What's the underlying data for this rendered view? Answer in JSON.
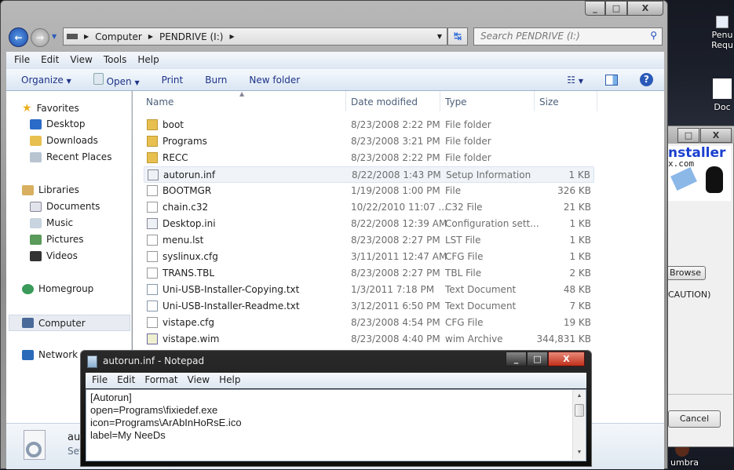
{
  "desktop": {
    "icons": [
      "Penu",
      "Requ",
      "Doc"
    ],
    "bottom_icon": "umbra"
  },
  "explorer": {
    "caption": {
      "minimize": "_",
      "maximize": "□",
      "close": "X"
    },
    "address": {
      "crumbs": [
        "Computer",
        "PENDRIVE (I:)"
      ]
    },
    "search": {
      "placeholder": "Search PENDRIVE (I:)"
    },
    "menu": [
      "File",
      "Edit",
      "View",
      "Tools",
      "Help"
    ],
    "toolbar": {
      "organize": "Organize",
      "open": "Open",
      "print": "Print",
      "burn": "Burn",
      "new_folder": "New folder"
    },
    "nav": {
      "favorites": "Favorites",
      "desktop": "Desktop",
      "downloads": "Downloads",
      "recent": "Recent Places",
      "libraries": "Libraries",
      "documents": "Documents",
      "music": "Music",
      "pictures": "Pictures",
      "videos": "Videos",
      "homegroup": "Homegroup",
      "computer": "Computer",
      "network": "Network"
    },
    "columns": {
      "name": "Name",
      "date": "Date modified",
      "type": "Type",
      "size": "Size"
    },
    "files": [
      {
        "name": "boot",
        "date": "8/23/2008 2:22 PM",
        "type": "File folder",
        "size": "",
        "icon": "folder"
      },
      {
        "name": "Programs",
        "date": "8/23/2008 3:21 PM",
        "type": "File folder",
        "size": "",
        "icon": "folder"
      },
      {
        "name": "RECC",
        "date": "8/23/2008 2:22 PM",
        "type": "File folder",
        "size": "",
        "icon": "folder"
      },
      {
        "name": "autorun.inf",
        "date": "8/22/2008 1:43 PM",
        "type": "Setup Information",
        "size": "1 KB",
        "icon": "settings"
      },
      {
        "name": "BOOTMGR",
        "date": "1/19/2008 1:00 PM",
        "type": "File",
        "size": "326 KB",
        "icon": "file"
      },
      {
        "name": "chain.c32",
        "date": "10/22/2010 11:07 ...",
        "type": "C32 File",
        "size": "21 KB",
        "icon": "file"
      },
      {
        "name": "Desktop.ini",
        "date": "8/22/2008 12:39 AM",
        "type": "Configuration sett...",
        "size": "1 KB",
        "icon": "settings"
      },
      {
        "name": "menu.lst",
        "date": "8/23/2008 2:27 PM",
        "type": "LST File",
        "size": "1 KB",
        "icon": "file"
      },
      {
        "name": "syslinux.cfg",
        "date": "3/11/2011 12:47 AM",
        "type": "CFG File",
        "size": "1 KB",
        "icon": "file"
      },
      {
        "name": "TRANS.TBL",
        "date": "8/23/2008 2:27 PM",
        "type": "TBL File",
        "size": "2 KB",
        "icon": "file"
      },
      {
        "name": "Uni-USB-Installer-Copying.txt",
        "date": "1/3/2011 7:18 PM",
        "type": "Text Document",
        "size": "48 KB",
        "icon": "text"
      },
      {
        "name": "Uni-USB-Installer-Readme.txt",
        "date": "3/12/2011 6:50 PM",
        "type": "Text Document",
        "size": "7 KB",
        "icon": "text"
      },
      {
        "name": "vistape.cfg",
        "date": "8/23/2008 4:54 PM",
        "type": "CFG File",
        "size": "19 KB",
        "icon": "file"
      },
      {
        "name": "vistape.wim",
        "date": "8/23/2008 4:40 PM",
        "type": "wim Archive",
        "size": "344,831 KB",
        "icon": "archive"
      }
    ],
    "details": {
      "name": "aut",
      "type": "Set"
    }
  },
  "notepad": {
    "title": "autorun.inf - Notepad",
    "menu": [
      "File",
      "Edit",
      "Format",
      "View",
      "Help"
    ],
    "lines": [
      "[Autorun]",
      "open=Programs\\fixiedef.exe",
      "icon=Programs\\ArAbInHoRsE.ico",
      "label=My NeeDs"
    ]
  },
  "installer": {
    "logo": "nstaller",
    "logo_sub": "x.com",
    "browse": "Browse",
    "caution": "CAUTION)",
    "cancel": "Cancel"
  }
}
